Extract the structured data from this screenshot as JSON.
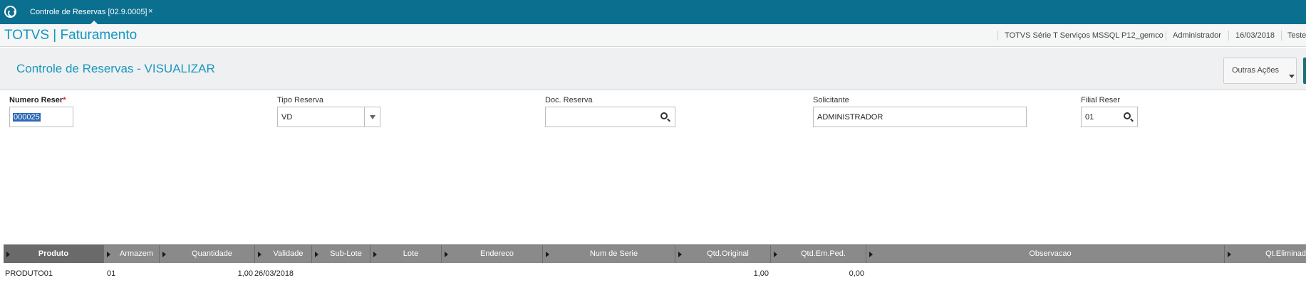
{
  "tab": {
    "title": "Controle de Reservas [02.9.0005]",
    "close": "×"
  },
  "app": {
    "title": "TOTVS | Faturamento",
    "environment": "TOTVS Série T Serviços MSSQL P12_gemco",
    "user": "Administrador",
    "date": "16/03/2018",
    "extra": "Teste"
  },
  "page": {
    "title": "Controle de Reservas - VISUALIZAR",
    "actions_label": "Outras Ações"
  },
  "form": {
    "numero_reserva": {
      "label": "Numero Reser",
      "required": "*",
      "value": "000025"
    },
    "tipo_reserva": {
      "label": "Tipo Reserva",
      "value": "VD"
    },
    "doc_reserva": {
      "label": "Doc. Reserva",
      "value": ""
    },
    "solicitante": {
      "label": "Solicitante",
      "value": "ADMINISTRADOR"
    },
    "filial_reserva": {
      "label": "Filial Reser",
      "value": "01"
    }
  },
  "grid": {
    "columns": [
      "Produto",
      "Armazem",
      "Quantidade",
      "Validade",
      "Sub-Lote",
      "Lote",
      "Endereco",
      "Num de Serie",
      "Qtd.Original",
      "Qtd.Em.Ped.",
      "Observacao",
      "Qt.Eliminad"
    ],
    "rows": [
      {
        "produto": "PRODUTO01",
        "armazem": "01",
        "quantidade": "1,00",
        "validade": "26/03/2018",
        "qtd_original": "1,00",
        "qtd_em_ped": "0,00"
      }
    ]
  },
  "colors": {
    "topbar": "#0b6f8f",
    "accent": "#1497c1",
    "grid_header": "#8a8a8a",
    "selection": "#2b68b6"
  }
}
